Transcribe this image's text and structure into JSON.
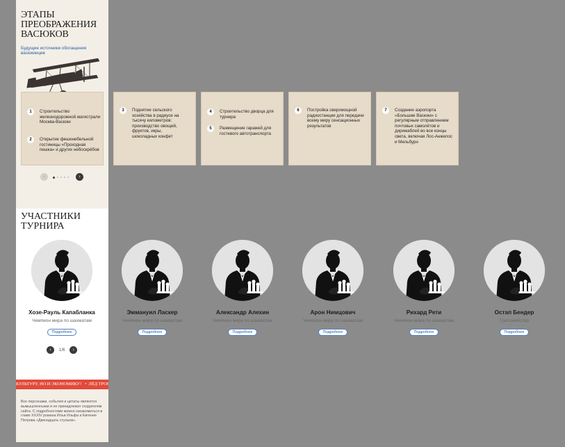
{
  "stages": {
    "title": "Этапы преображения Васюков",
    "subtitle": "Будущие источники обогащения васюкинцев",
    "cards": [
      {
        "steps": [
          {
            "num": "1",
            "text": "Строительство железнодорожной магистрали Москва-Васюки"
          },
          {
            "num": "2",
            "text": "Открытие фешенебельной гостиницы «Проходная пешка» и других небоскрёбов"
          }
        ]
      },
      {
        "steps": [
          {
            "num": "3",
            "text": "Поднятие сельского хозяйства в радиусе на тысячу километров: производство овощей, фруктов, икры, шоколадных конфет"
          }
        ]
      },
      {
        "steps": [
          {
            "num": "4",
            "text": "Строительство дворца для турнира"
          },
          {
            "num": "5",
            "text": "Размещение гаражей для гостевого автотранспорта"
          }
        ]
      },
      {
        "steps": [
          {
            "num": "6",
            "text": "Постройка сверхмощной радиостанции для передачи всему миру сенсационных результатов"
          }
        ]
      },
      {
        "steps": [
          {
            "num": "7",
            "text": "Создание аэропорта «Большие Васюки» с регулярным отправлением почтовых самолётов и дирижаблей во все концы света, включая Лос-Анжелос и Мельбурн"
          }
        ]
      }
    ],
    "prev_icon": "‹",
    "next_icon": "›",
    "dots": 5,
    "active_dot": 0
  },
  "members": {
    "title": "Участники турнира",
    "details_label": "Подробнее",
    "list": [
      {
        "name": "Хозе-Рауль Капабланка",
        "role": "Чемпион мира по шахматам"
      },
      {
        "name": "Эммануил Ласкер",
        "role": "Чемпион мира по шахматам"
      },
      {
        "name": "Александр Алехин",
        "role": "Чемпион мира по шахматам"
      },
      {
        "name": "Арон Нимцович",
        "role": "Чемпион мира по шахматам"
      },
      {
        "name": "Рихард Рети",
        "role": "Чемпион мира по шахматам"
      },
      {
        "name": "Остап Бендер",
        "role": "Гроссмейстер"
      }
    ],
    "pager": "1/6",
    "prev_icon": "‹",
    "next_icon": "›"
  },
  "ticker": {
    "items": [
      "Культуру, но и экономику!",
      "•",
      "Лёд тронулся"
    ]
  },
  "footer": {
    "disclaimer": "Все персонажи, события и цитаты являются вымышленными и не принадлежат создателям сайта. С подробностями можно ознакомиться в главе XXXIV романа Ильи Ильфа и Евгения Петрова «Двенадцать стульев»."
  },
  "colors": {
    "background": "#8b8b8b",
    "panel": "#f3efe7",
    "card": "#e7dbc9",
    "accent": "#e24a3b",
    "link": "#2d5e9e"
  },
  "icons": {
    "plane": "biplane-illustration",
    "avatar": "chess-player-silhouette"
  }
}
